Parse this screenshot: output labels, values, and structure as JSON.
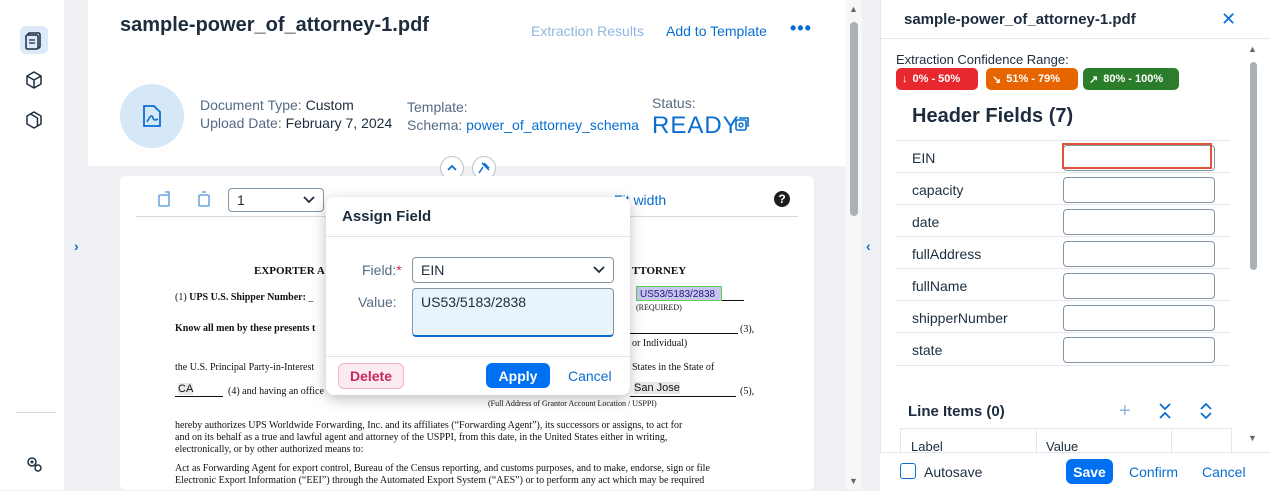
{
  "document": {
    "title": "sample-power_of_attorney-1.pdf",
    "tab_extraction": "Extraction Results",
    "add_to_template": "Add to Template",
    "more": "•••",
    "type_label": "Document Type:",
    "type_value": "Custom",
    "upload_label": "Upload Date:",
    "upload_value": "February 7, 2024",
    "template_label": "Template:",
    "schema_label": "Schema:",
    "schema_value": "power_of_attorney_schema",
    "status_label": "Status:",
    "status_value": "READY"
  },
  "viewer": {
    "page_value": "1",
    "fit_width": "Fit width",
    "help": "?",
    "pdf": {
      "heading_left": "EXPORTER A",
      "heading_right": "TTORNEY",
      "line1_prefix": "(1)",
      "line1_bold": "UPS U.S. Shipper Number:",
      "highlight_value": "US53/5183/2838",
      "required": "(REQUIRED)",
      "line2": "Know all men by these presents t",
      "line2_end": "(3),",
      "line2b": "or Individual)",
      "line3": "the U.S. Principal Party-in-Interest",
      "line3_right": "States in the State of",
      "state_value": "CA",
      "line4": "(4) and having an office",
      "city_value": "San Jose",
      "line4_end": "(5),",
      "address_caption": "(Full Address of Grantor Account Location / USPPI)",
      "para1": "hereby authorizes UPS Worldwide Forwarding, Inc. and its affiliates (“Forwarding Agent”), its successors or assigns, to act for",
      "para2": "and on its behalf as a true and lawful agent and attorney of the USPPI, from this date, in the United States either in writing,",
      "para3": "electronically, or by other authorized means to:",
      "para4": "Act as Forwarding Agent for export control, Bureau of the Census reporting, and customs purposes, and to make, endorse, sign or file",
      "para5": "Electronic Export Information (“EEI”) through the Automated Export System (“AES”) or to perform any act which may be required"
    }
  },
  "dialog": {
    "title": "Assign Field",
    "field_label": "Field:",
    "field_required": "*",
    "field_value": "EIN",
    "value_label": "Value:",
    "value_text": "US53/5183/2838",
    "delete": "Delete",
    "apply": "Apply",
    "cancel": "Cancel"
  },
  "panel": {
    "title": "sample-power_of_attorney-1.pdf",
    "close": "✕",
    "confidence_label": "Extraction Confidence Range:",
    "badges": [
      {
        "label": "0% - 50%",
        "color": "#e8282f"
      },
      {
        "label": "51% - 79%",
        "color": "#e76500"
      },
      {
        "label": "80% - 100%",
        "color": "#2b7d2b"
      }
    ],
    "header_fields_title": "Header Fields (7)",
    "fields": [
      {
        "label": "EIN",
        "value": ""
      },
      {
        "label": "capacity",
        "value": ""
      },
      {
        "label": "date",
        "value": ""
      },
      {
        "label": "fullAddress",
        "value": ""
      },
      {
        "label": "fullName",
        "value": ""
      },
      {
        "label": "shipperNumber",
        "value": ""
      },
      {
        "label": "state",
        "value": ""
      }
    ],
    "line_items_title": "Line Items (0)",
    "line_items_columns": [
      "Label",
      "Value"
    ],
    "autosave": "Autosave",
    "save": "Save",
    "confirm": "Confirm",
    "cancel": "Cancel"
  }
}
